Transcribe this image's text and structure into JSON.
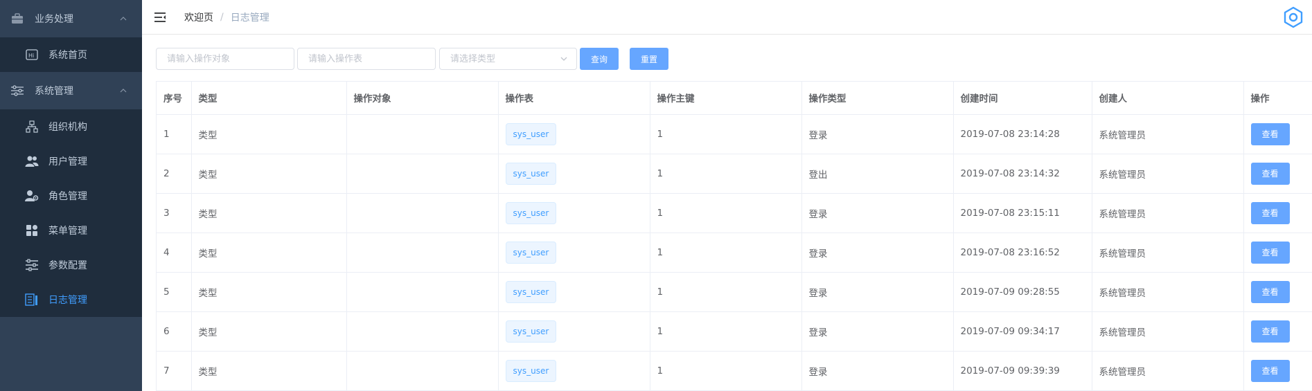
{
  "sidebar": {
    "group1": {
      "label": "业务处理",
      "icon": "briefcase-icon"
    },
    "group1_items": [
      {
        "label": "系统首页",
        "icon": "hi-icon"
      }
    ],
    "group2": {
      "label": "系统管理",
      "icon": "sliders-icon"
    },
    "group2_items": [
      {
        "label": "组织机构",
        "icon": "org-tree-icon"
      },
      {
        "label": "用户管理",
        "icon": "users-icon"
      },
      {
        "label": "角色管理",
        "icon": "user-gear-icon"
      },
      {
        "label": "菜单管理",
        "icon": "grid-icon"
      },
      {
        "label": "参数配置",
        "icon": "settings-sliders-icon"
      },
      {
        "label": "日志管理",
        "icon": "log-icon",
        "active": true
      }
    ]
  },
  "header": {
    "breadcrumb_home": "欢迎页",
    "breadcrumb_sep": "/",
    "breadcrumb_current": "日志管理"
  },
  "filters": {
    "object_placeholder": "请输入操作对象",
    "table_placeholder": "请输入操作表",
    "type_placeholder": "请选择类型",
    "query_label": "查询",
    "reset_label": "重置"
  },
  "table": {
    "columns": [
      "序号",
      "类型",
      "操作对象",
      "操作表",
      "操作主键",
      "操作类型",
      "创建时间",
      "创建人",
      "操作"
    ],
    "view_label": "查看",
    "rows": [
      {
        "idx": "1",
        "type": "类型",
        "object": "",
        "table": "sys_user",
        "key": "1",
        "op": "登录",
        "time": "2019-07-08 23:14:28",
        "creator": "系统管理员"
      },
      {
        "idx": "2",
        "type": "类型",
        "object": "",
        "table": "sys_user",
        "key": "1",
        "op": "登出",
        "time": "2019-07-08 23:14:32",
        "creator": "系统管理员"
      },
      {
        "idx": "3",
        "type": "类型",
        "object": "",
        "table": "sys_user",
        "key": "1",
        "op": "登录",
        "time": "2019-07-08 23:15:11",
        "creator": "系统管理员"
      },
      {
        "idx": "4",
        "type": "类型",
        "object": "",
        "table": "sys_user",
        "key": "1",
        "op": "登录",
        "time": "2019-07-08 23:16:52",
        "creator": "系统管理员"
      },
      {
        "idx": "5",
        "type": "类型",
        "object": "",
        "table": "sys_user",
        "key": "1",
        "op": "登录",
        "time": "2019-07-09 09:28:55",
        "creator": "系统管理员"
      },
      {
        "idx": "6",
        "type": "类型",
        "object": "",
        "table": "sys_user",
        "key": "1",
        "op": "登录",
        "time": "2019-07-09 09:34:17",
        "creator": "系统管理员"
      },
      {
        "idx": "7",
        "type": "类型",
        "object": "",
        "table": "sys_user",
        "key": "1",
        "op": "登录",
        "time": "2019-07-09 09:39:39",
        "creator": "系统管理员"
      }
    ]
  },
  "colors": {
    "sidebar_bg": "#304156",
    "submenu_bg": "#1f2d3d",
    "accent": "#409eff",
    "button": "#66a6ff"
  }
}
